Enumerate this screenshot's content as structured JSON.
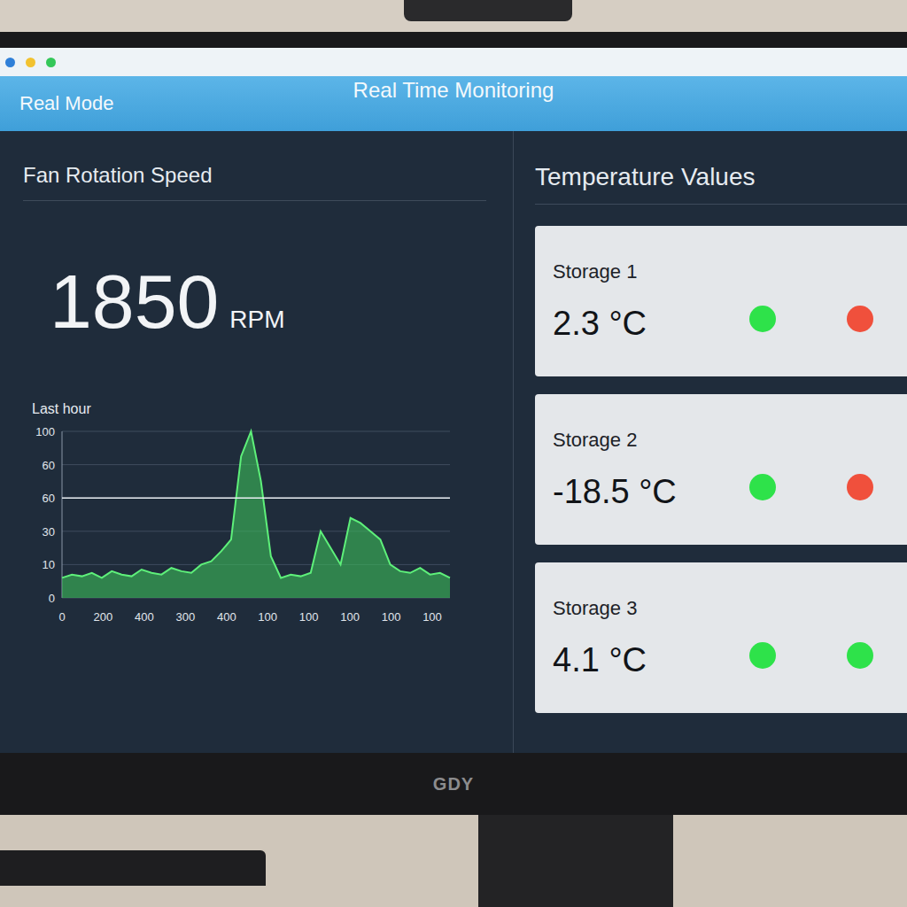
{
  "window": {
    "title": "Real Time Monitoring",
    "mode": "Real Mode",
    "controls": [
      {
        "color": "#2f7fd8"
      },
      {
        "color": "#f2c230"
      },
      {
        "color": "#34c759"
      }
    ]
  },
  "monitor": {
    "brand": "GDY"
  },
  "fan": {
    "title": "Fan Rotation Speed",
    "value": "1850",
    "unit": "RPM",
    "chart": {
      "title": "Last hour",
      "y_ticks": [
        "100",
        "60",
        "60",
        "30",
        "10",
        "0"
      ],
      "x_ticks": [
        "0",
        "200",
        "400",
        "300",
        "400",
        "100",
        "100",
        "100",
        "100",
        "100"
      ],
      "threshold": 60,
      "series": [
        {
          "values": [
            12,
            14,
            13,
            15,
            12,
            16,
            14,
            13,
            17,
            15,
            14,
            18,
            16,
            15,
            20,
            22,
            28,
            35,
            85,
            100,
            70,
            25,
            12,
            14,
            13,
            15,
            40,
            30,
            20,
            48,
            45,
            40,
            35,
            20,
            16,
            15,
            18,
            14,
            15,
            12
          ]
        }
      ]
    }
  },
  "temperatures": {
    "title": "Temperature Values",
    "sensors": [
      {
        "name": "Storage 1",
        "reading": "2.3 °C",
        "indicators": [
          {
            "color": "#2ee24a"
          },
          {
            "color": "#f0503c"
          }
        ]
      },
      {
        "name": "Storage 2",
        "reading": "-18.5 °C",
        "indicators": [
          {
            "color": "#2ee24a"
          },
          {
            "color": "#f0503c"
          }
        ]
      },
      {
        "name": "Storage 3",
        "reading": "4.1 °C",
        "indicators": [
          {
            "color": "#2ee24a"
          },
          {
            "color": "#2ee24a"
          }
        ]
      }
    ]
  }
}
